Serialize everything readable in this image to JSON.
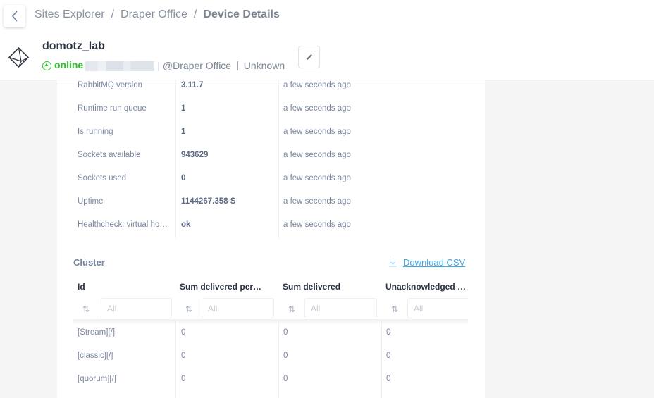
{
  "header": {
    "breadcrumb": [
      "Sites Explorer",
      "Draper Office",
      "Device Details"
    ],
    "breadcrumb_separator": "/",
    "device_name": "domotz_lab",
    "status": "online",
    "status_color": "#2ec02e",
    "site_prefix": "@",
    "site_name": "Draper Office",
    "device_type": "Unknown",
    "icons": {
      "back": "chevron-left-icon",
      "device": "octahedron-device-icon",
      "edit": "pencil-icon",
      "status": "arrow-up-circle-icon"
    }
  },
  "metrics": [
    {
      "name": "RabbitMQ version",
      "value": "3.11.7",
      "updated": "a few seconds ago"
    },
    {
      "name": "Runtime run queue",
      "value": "1",
      "updated": "a few seconds ago"
    },
    {
      "name": "Is running",
      "value": "1",
      "updated": "a few seconds ago"
    },
    {
      "name": "Sockets available",
      "value": "943629",
      "updated": "a few seconds ago"
    },
    {
      "name": "Sockets used",
      "value": "0",
      "updated": "a few seconds ago"
    },
    {
      "name": "Uptime",
      "value": "1144267.358 S",
      "updated": "a few seconds ago"
    },
    {
      "name": "Healthcheck: virtual ho…",
      "value": "ok",
      "updated": "a few seconds ago"
    }
  ],
  "cluster": {
    "title": "Cluster",
    "download_label": "Download CSV",
    "accent_color": "#3ea7e8",
    "columns": [
      "Id",
      "Sum delivered per…",
      "Sum delivered",
      "Unacknowledged …"
    ],
    "filter_placeholder": "All",
    "sort_glyph": "⇅",
    "rows": [
      [
        "[Stream][/]",
        "0",
        "0",
        "0"
      ],
      [
        "[classic][/]",
        "0",
        "0",
        "0"
      ],
      [
        "[quorum][/]",
        "0",
        "0",
        "0"
      ]
    ]
  }
}
